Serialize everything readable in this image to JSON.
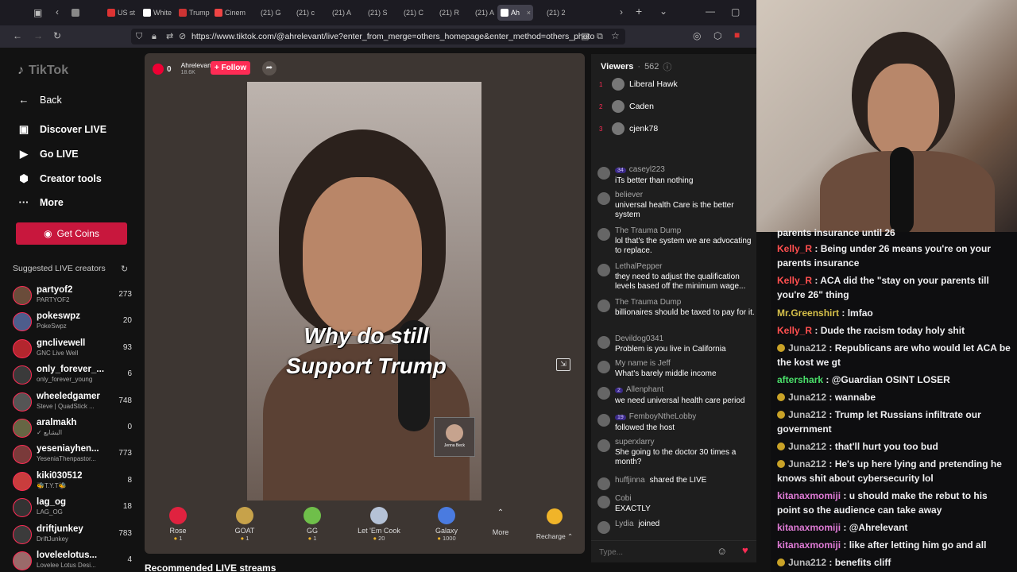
{
  "browser": {
    "tabs": [
      {
        "label": "",
        "active": false
      },
      {
        "label": "US st",
        "active": false
      },
      {
        "label": "White",
        "active": false
      },
      {
        "label": "Trump",
        "active": false
      },
      {
        "label": "Cinem",
        "active": false
      },
      {
        "label": "(21) G",
        "active": false
      },
      {
        "label": "(21) c",
        "active": false
      },
      {
        "label": "(21) A",
        "active": false
      },
      {
        "label": "(21) S",
        "active": false
      },
      {
        "label": "(21) C",
        "active": false
      },
      {
        "label": "(21) R",
        "active": false
      },
      {
        "label": "(21) A",
        "active": false
      },
      {
        "label": "Ah",
        "active": true
      },
      {
        "label": "(21) 2",
        "active": false
      }
    ],
    "url": "https://www.tiktok.com/@ahrelevant/live?enter_from_merge=others_homepage&enter_method=others_photo"
  },
  "nav": {
    "logo": "TikTok",
    "back": "Back",
    "items": [
      "Discover LIVE",
      "Go LIVE",
      "Creator tools",
      "More"
    ],
    "get_coins": "Get Coins",
    "suggested_title": "Suggested LIVE creators"
  },
  "creators": [
    {
      "name": "partyof2",
      "sub": "PARTYOF2",
      "count": "273"
    },
    {
      "name": "pokeswpz",
      "sub": "PokeSwpz",
      "count": "20"
    },
    {
      "name": "gnclivewell",
      "sub": "GNC Live Well",
      "count": "93"
    },
    {
      "name": "only_forever_...",
      "sub": "only_forever_young",
      "count": "6"
    },
    {
      "name": "wheeledgamer",
      "sub": "Steve | QuadStick ...",
      "count": "748"
    },
    {
      "name": "aralmakh",
      "sub": "✓ البشايع",
      "count": "0"
    },
    {
      "name": "yeseniayhen...",
      "sub": "YeseniaThenpastor...",
      "count": "773"
    },
    {
      "name": "kiki030512",
      "sub": "🐝T.Y.T🐝",
      "count": "8"
    },
    {
      "name": "lag_og",
      "sub": "LAG_OG",
      "count": "18"
    },
    {
      "name": "driftjunkey",
      "sub": "DriftJunkey",
      "count": "783"
    },
    {
      "name": "loveleelotus...",
      "sub": "Loveleе Lotus Desi...",
      "count": "4"
    }
  ],
  "stream": {
    "host": "Ahrelevant",
    "host_likes": "18.6K",
    "follow": "+ Follow",
    "rank_badge": "0",
    "caption_line1": "Why do still",
    "caption_line2": "Support Trump",
    "pip_name": "Jenna Beck",
    "recommended": "Recommended LIVE streams"
  },
  "gifts": [
    {
      "name": "Rose",
      "cost": "1",
      "color": "#e0223f"
    },
    {
      "name": "GOAT",
      "cost": "1",
      "color": "#c7a24a"
    },
    {
      "name": "GG",
      "cost": "1",
      "color": "#6fbf4a"
    },
    {
      "name": "Let 'Em Cook",
      "cost": "20",
      "color": "#b5c2d6"
    },
    {
      "name": "Galaxy",
      "cost": "1000",
      "color": "#4a7be0"
    }
  ],
  "gift_more": "More",
  "recharge": "Recharge",
  "viewers": {
    "title": "Viewers",
    "count": "562",
    "top": [
      {
        "rank": "1",
        "name": "Liberal Hawk"
      },
      {
        "rank": "2",
        "name": "Caden"
      },
      {
        "rank": "3",
        "name": "cjenk78"
      }
    ]
  },
  "chat": [
    {
      "user": "caseyl223",
      "badge": "34",
      "text": "iTs better than nothing"
    },
    {
      "user": "believer",
      "badge": "",
      "text": "universal health Care is the better system"
    },
    {
      "user": "The Trauma Dump",
      "badge": "",
      "text": "lol that's the system we are advocating to replace."
    },
    {
      "user": "LethalPepper",
      "badge": "",
      "text": "they need to adjust the qualification levels based off the minimum wage..."
    },
    {
      "user": "The Trauma Dump",
      "badge": "",
      "text": "billionaires should be taxed to pay for it."
    },
    {
      "user": "Devildog0341",
      "badge": "",
      "text": "Problem is you live in California"
    },
    {
      "user": "My name is Jeff",
      "badge": "",
      "text": "What's barely middle income"
    },
    {
      "user": "Allenphant",
      "badge": "2",
      "text": "we need universal health care period"
    },
    {
      "user": "FemboyNtheLobby",
      "badge": "19",
      "text": "followed the host"
    },
    {
      "user": "superxlarry",
      "badge": "",
      "text": "She going to the doctor 30 times a month?"
    },
    {
      "user": "huffjinna",
      "badge": "",
      "text": "shared the LIVE"
    },
    {
      "user": "Cobi",
      "badge": "",
      "text": "EXACTLY"
    },
    {
      "user": "Lydia",
      "badge": "",
      "text": "joined"
    }
  ],
  "chat_input_placeholder": "Type...",
  "twitch_chat": [
    {
      "name": "",
      "color": "#ff4f4f",
      "text": "parents insurance until 26",
      "badge": false
    },
    {
      "name": "Kelly_R",
      "color": "#ff4f4f",
      "text": "Being under 26 means you're on your parents insurance",
      "badge": false
    },
    {
      "name": "Kelly_R",
      "color": "#ff4f4f",
      "text": "ACA did the \"stay on your parents till you're 26\" thing",
      "badge": false
    },
    {
      "name": "Mr.Greenshirt",
      "color": "#d6c04a",
      "text": "lmfao",
      "badge": false
    },
    {
      "name": "Kelly_R",
      "color": "#ff4f4f",
      "text": "Dude the racism today holy shit",
      "badge": false
    },
    {
      "name": "Juna212",
      "color": "#bdbdbd",
      "text": "Republicans are who would let ACA be the kost we gt",
      "badge": true
    },
    {
      "name": "aftershark",
      "color": "#4ae06a",
      "text": "@Guardian OSINT LOSER",
      "badge": false
    },
    {
      "name": "Juna212",
      "color": "#bdbdbd",
      "text": "wannabe",
      "badge": true
    },
    {
      "name": "Juna212",
      "color": "#bdbdbd",
      "text": "Trump let Russians infiltrate our government",
      "badge": true
    },
    {
      "name": "Juna212",
      "color": "#bdbdbd",
      "text": "that'll hurt you too bud",
      "badge": true
    },
    {
      "name": "Juna212",
      "color": "#bdbdbd",
      "text": "He's up here lying and pretending he knows shit about cybersecurity lol",
      "badge": true
    },
    {
      "name": "kitanaxmomiji",
      "color": "#e07bd6",
      "text": "u should make the rebut to his point so the audience can take away",
      "badge": false
    },
    {
      "name": "kitanaxmomiji",
      "color": "#e07bd6",
      "text": "@Ahrelevant",
      "badge": false
    },
    {
      "name": "kitanaxmomiji",
      "color": "#e07bd6",
      "text": "like after letting him go and all",
      "badge": false
    },
    {
      "name": "Juna212",
      "color": "#bdbdbd",
      "text": "benefits cliff",
      "badge": true
    }
  ]
}
